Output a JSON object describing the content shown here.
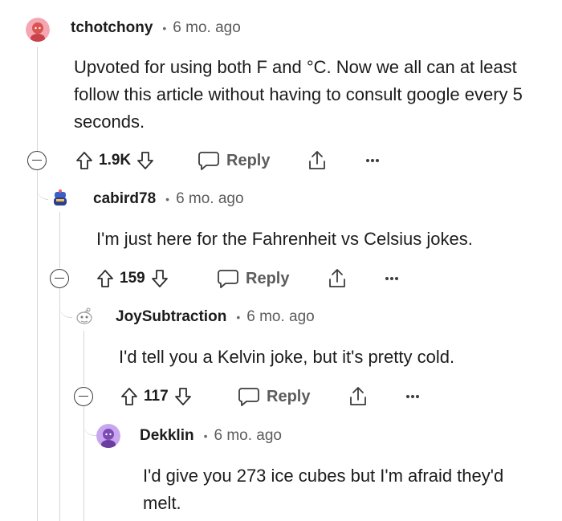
{
  "comments": [
    {
      "username": "tchotchony",
      "separator": "•",
      "age": "6 mo. ago",
      "body": "Upvoted for using both F and °C. Now we all can at least follow this article without having to consult google every 5 seconds.",
      "score": "1.9K",
      "reply_label": "Reply",
      "avatar_color": "#f4a6b2"
    },
    {
      "username": "cabird78",
      "separator": "•",
      "age": "6 mo. ago",
      "body": "I'm just here for the Fahrenheit vs Celsius jokes.",
      "score": "159",
      "reply_label": "Reply",
      "avatar_color": "#3b5fc9"
    },
    {
      "username": "JoySubtraction",
      "separator": "•",
      "age": "6 mo. ago",
      "body": "I'd tell you a Kelvin joke, but it's pretty cold.",
      "score": "117",
      "reply_label": "Reply",
      "avatar_color": "#e8e8e8"
    },
    {
      "username": "Dekklin",
      "separator": "•",
      "age": "6 mo. ago",
      "body": "I'd give you 273 ice cubes but I'm afraid they'd melt.",
      "avatar_color": "#c9a6f0"
    }
  ],
  "icons": {
    "upvote": "arrow-up-icon",
    "downvote": "arrow-down-icon",
    "reply": "speech-bubble-icon",
    "share": "share-icon",
    "more": "more-options-icon",
    "collapse": "collapse-thread-icon"
  }
}
